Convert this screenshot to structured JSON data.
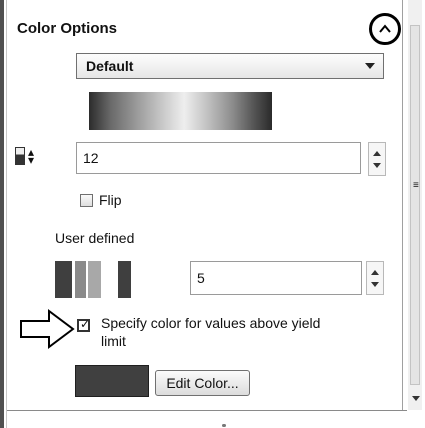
{
  "panel": {
    "title": "Color Options",
    "color_map_select": {
      "value": "Default"
    },
    "number_of_colors": {
      "value": "12"
    },
    "flip": {
      "label": "Flip",
      "checked": false
    },
    "user_defined": {
      "label": "User defined",
      "count": "5",
      "swatch_colors": [
        "#3f3f3f",
        "#8a8a8a",
        "#a8a8a8",
        "#3f3f3f",
        "#ffffff"
      ]
    },
    "yield": {
      "label_line1": "Specify color for values above yield",
      "label_line2": "limit",
      "checked": true,
      "color": "#404040"
    },
    "edit_color_label": "Edit Color..."
  }
}
